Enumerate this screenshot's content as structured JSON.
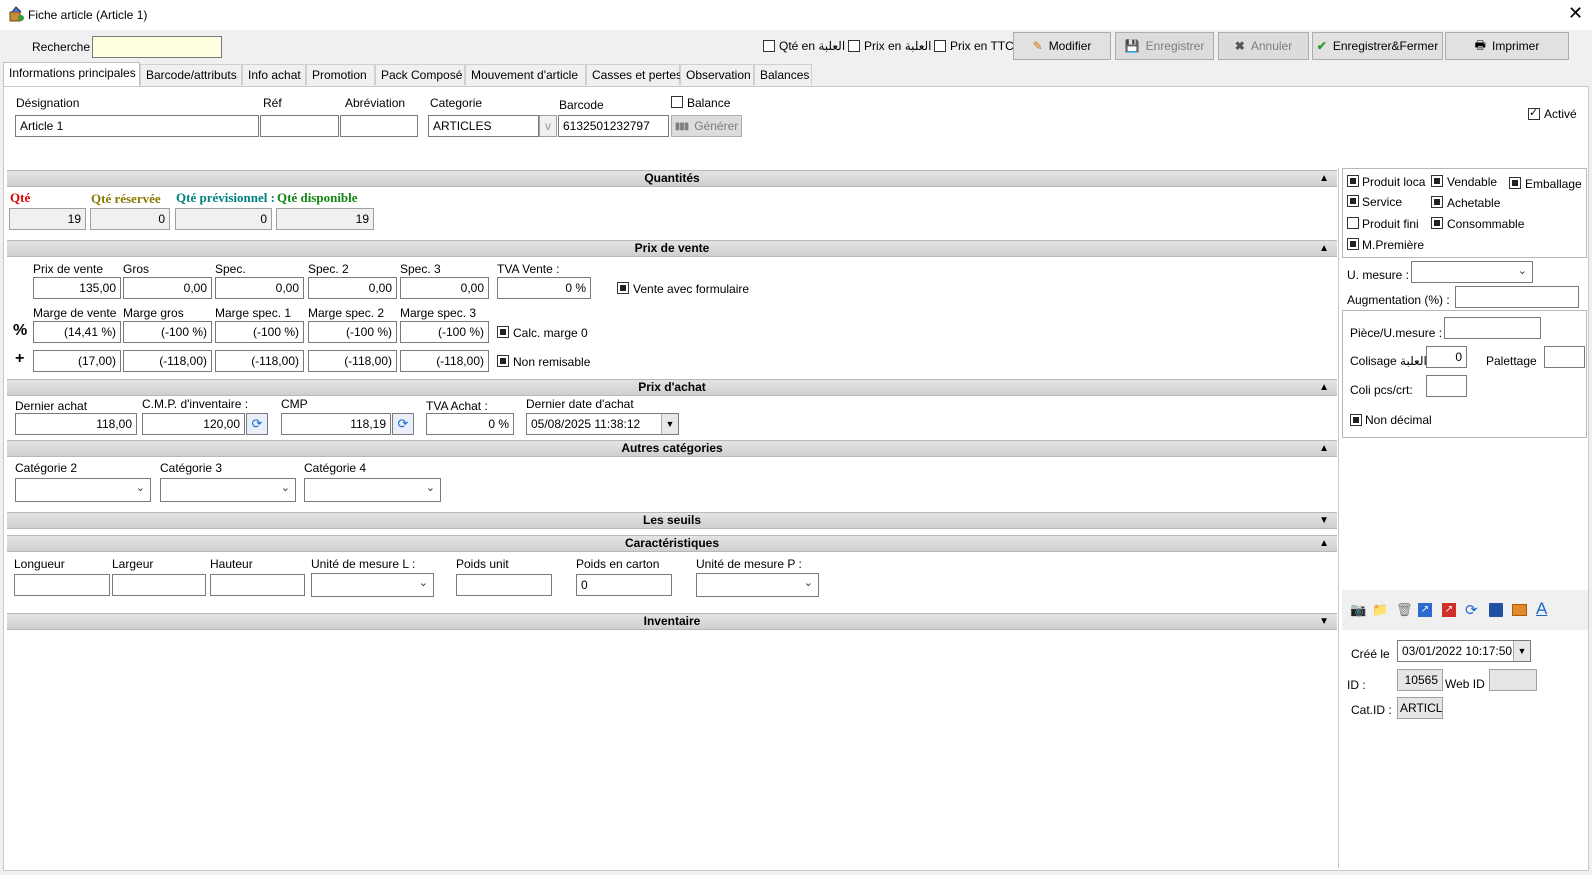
{
  "window": {
    "title": "Fiche article  (Article 1)"
  },
  "toolbar": {
    "search_label": "Recherche :",
    "search_value": "",
    "chk_qte_ttc": "Qté en العلبة",
    "chk_prix_ttc": "Prix en العلبة",
    "chk_prix_en_ttc": "Prix en TTC",
    "modifier": "Modifier",
    "enregistrer": "Enregistrer",
    "annuler": "Annuler",
    "enregistrer_fermer": "Enregistrer&Fermer",
    "imprimer": "Imprimer"
  },
  "tabs": [
    "Informations principales",
    "Barcode/attributs",
    "Info achat",
    "Promotion",
    "Pack Composé",
    "Mouvement d'article",
    "Casses et pertes",
    "Observation",
    "Balances"
  ],
  "header": {
    "designation_label": "Désignation",
    "designation": "Article 1",
    "ref_label": "Réf",
    "ref": "",
    "abrev_label": "Abréviation",
    "abrev": "",
    "categorie_label": "Categorie",
    "categorie": "ARTICLES",
    "categorie_btn": "v",
    "barcode_label": "Barcode",
    "barcode": "6132501232797",
    "balance_label": "Balance",
    "generer": "Générer",
    "active_label": "Activé"
  },
  "quantites": {
    "title": "Quantités",
    "qte_label": "Qté",
    "qte": "19",
    "reservee_label": "Qté réservée",
    "reservee": "0",
    "prev_label": "Qté prévisionnel :",
    "prev": "0",
    "dispo_label": "Qté disponible",
    "dispo": "19"
  },
  "prix_vente": {
    "title": "Prix de vente",
    "labels": [
      "Prix de vente",
      "Gros",
      "Spec.",
      "Spec. 2",
      "Spec. 3"
    ],
    "values": [
      "135,00",
      "0,00",
      "0,00",
      "0,00",
      "0,00"
    ],
    "tva_label": "TVA Vente :",
    "tva": "0 %",
    "vente_formulaire": "Vente avec formulaire",
    "marge_labels": [
      "Marge de vente",
      "Marge gros",
      "Marge spec. 1",
      "Marge spec. 2",
      "Marge spec. 3"
    ],
    "pct_sign": "%",
    "pct_values": [
      "(14,41 %)",
      "(-100 %)",
      "(-100 %)",
      "(-100 %)",
      "(-100 %)"
    ],
    "calc_marge": "Calc. marge 0",
    "plus_sign": "+",
    "plus_values": [
      "(17,00)",
      "(-118,00)",
      "(-118,00)",
      "(-118,00)",
      "(-118,00)"
    ],
    "non_remisable": "Non remisable"
  },
  "prix_achat": {
    "title": "Prix d'achat",
    "dernier_label": "Dernier achat",
    "dernier": "118,00",
    "cmp_inv_label": "C.M.P. d'inventaire :",
    "cmp_inv": "120,00",
    "cmp_label": "CMP",
    "cmp": "118,19",
    "tva_label": "TVA Achat :",
    "tva": "0 %",
    "date_label": "Dernier date d'achat",
    "date": "05/08/2025   11:38:12"
  },
  "autres": {
    "title": "Autres catégories",
    "labels": [
      "Catégorie 2",
      "Catégorie 3",
      "Catégorie 4"
    ]
  },
  "seuils": {
    "title": "Les seuils"
  },
  "caract": {
    "title": "Caractéristiques",
    "longueur": "Longueur",
    "largeur": "Largeur",
    "hauteur": "Hauteur",
    "unite_l": "Unité de mesure L :",
    "poids_unit": "Poids unit",
    "poids_carton": "Poids en carton",
    "poids_carton_val": "0",
    "unite_p": "Unité de mesure P :"
  },
  "inventaire": {
    "title": "Inventaire"
  },
  "right": {
    "produit_local": "Produit loca",
    "vendable": "Vendable",
    "emballage": "Emballage",
    "service": "Service",
    "achetable": "Achetable",
    "produit_fini": "Produit fini",
    "consommable": "Consommable",
    "m_premiere": "M.Première",
    "u_mesure": "U. mesure :",
    "augmentation": "Augmentation (%) :",
    "piece_u": "Pièce/U.mesure :",
    "colisage": "Colisage العلبة",
    "colisage_val": "0",
    "palettage": "Palettage",
    "coli_pcs": "Coli pcs/crt:",
    "non_decimal": "Non décimal",
    "cree_le": "Créé le",
    "cree_date": "03/01/2022   10:17:50",
    "id_label": "ID :",
    "id": "10565",
    "web_id": "Web ID :",
    "cat_id": "Cat.ID :",
    "cat_id_val": "ARTICLE"
  },
  "colors": {
    "qte": "#e00000",
    "reservee": "#8a7a00",
    "prev": "#008080",
    "dispo": "#118811"
  }
}
